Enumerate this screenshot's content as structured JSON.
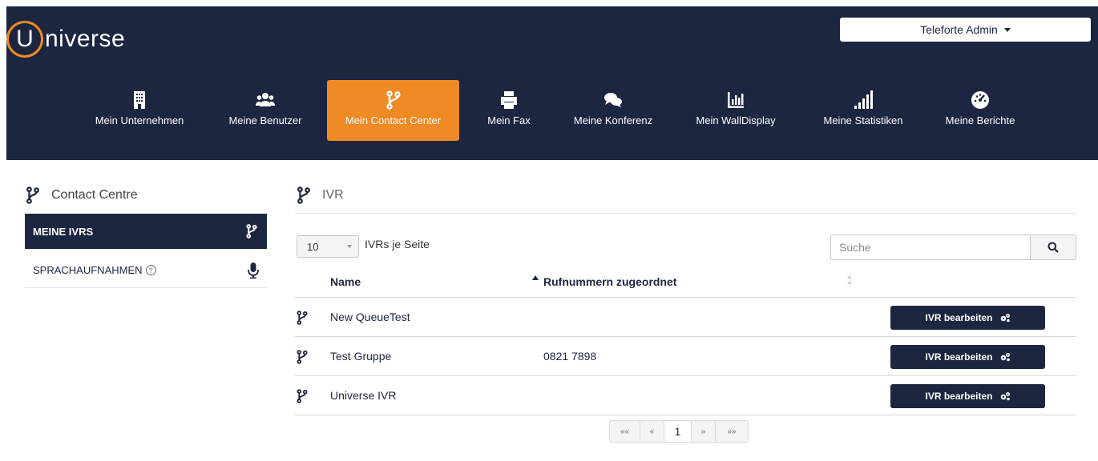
{
  "app": {
    "logo_letter": "U",
    "logo_text": "niverse",
    "brand_orange": "#f08a24",
    "brand_navy": "#1c2640"
  },
  "user_menu": {
    "label": "Teleforte Admin"
  },
  "nav": [
    {
      "label": "Mein Unternehmen",
      "icon": "building-icon"
    },
    {
      "label": "Meine Benutzer",
      "icon": "users-icon"
    },
    {
      "label": "Mein Contact Center",
      "icon": "branch-icon",
      "active": true
    },
    {
      "label": "Mein Fax",
      "icon": "printer-icon"
    },
    {
      "label": "Meine Konferenz",
      "icon": "chat-icon"
    },
    {
      "label": "Mein WallDisplay",
      "icon": "bar-chart-icon"
    },
    {
      "label": "Meine Statistiken",
      "icon": "signal-icon"
    },
    {
      "label": "Meine Berichte",
      "icon": "dashboard-icon"
    }
  ],
  "sidebar": {
    "title": "Contact Centre",
    "items": [
      {
        "label": "MEINE IVRS",
        "icon": "branch-icon",
        "active": true
      },
      {
        "label": "SPRACHAUFNAHMEN",
        "help": "?",
        "icon": "microphone-icon"
      }
    ]
  },
  "main": {
    "title": "IVR",
    "page_size": "10",
    "page_size_label": "IVRs je Seite",
    "search_placeholder": "Suche",
    "columns": [
      "Name",
      "Rufnummern zugeordnet"
    ],
    "rows": [
      {
        "name": "New QueueTest",
        "numbers": "",
        "action": "IVR bearbeiten"
      },
      {
        "name": "Test Gruppe",
        "numbers": "0821 7898",
        "action": "IVR bearbeiten"
      },
      {
        "name": "Universe IVR",
        "numbers": "",
        "action": "IVR bearbeiten"
      }
    ],
    "pagination": {
      "first": "««",
      "prev": "«",
      "current": "1",
      "next": "»",
      "last": "»»"
    }
  }
}
